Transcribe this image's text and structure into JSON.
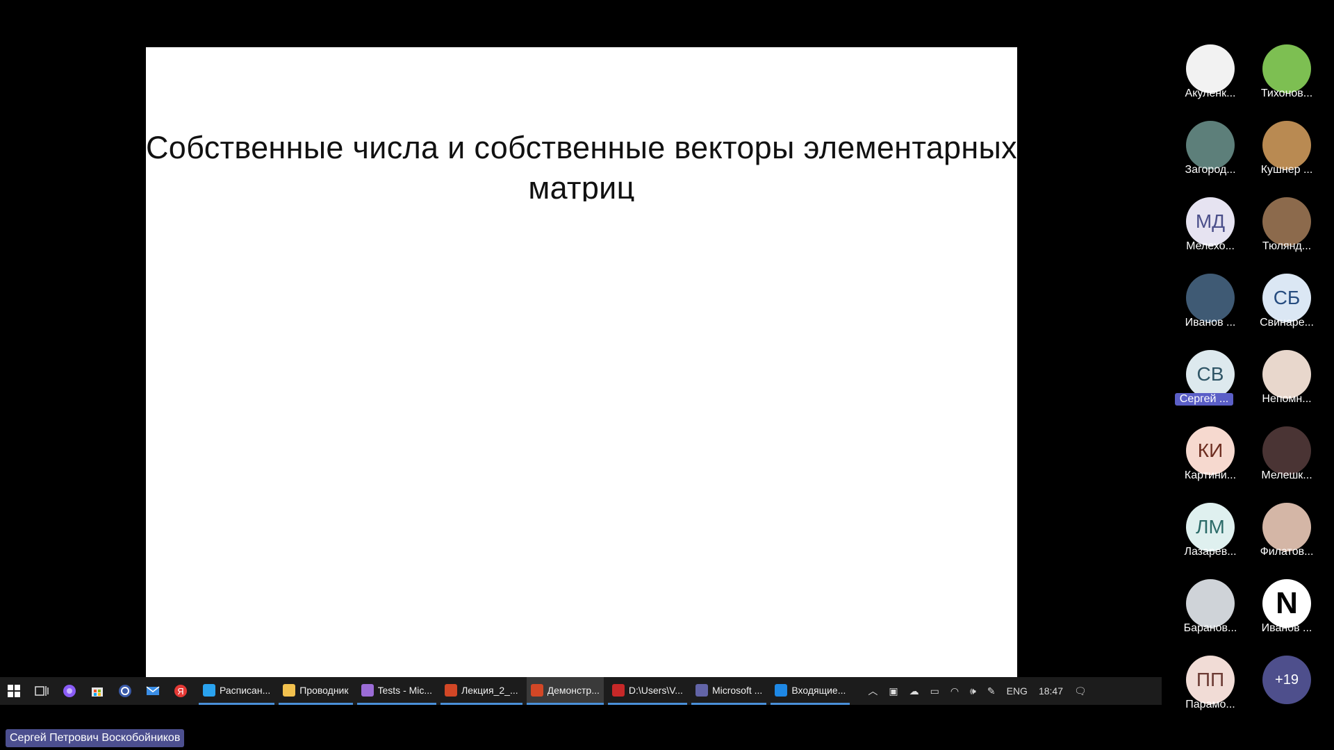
{
  "slide": {
    "title": "Собственные числа и собственные векторы элементарных матриц"
  },
  "taskbar": {
    "apps": [
      {
        "label": "Расписан...",
        "icon": "edge-icon",
        "color": "#2aa3ef"
      },
      {
        "label": "Проводник",
        "icon": "folder-icon",
        "color": "#f2c14e"
      },
      {
        "label": "Tests - Mic...",
        "icon": "visual-studio-icon",
        "color": "#9b6cd6"
      },
      {
        "label": "Лекция_2_...",
        "icon": "powerpoint-icon",
        "color": "#d24726"
      },
      {
        "label": "Демонстр...",
        "icon": "powerpoint-icon",
        "color": "#d24726"
      },
      {
        "label": "D:\\Users\\V...",
        "icon": "calendar-app-icon",
        "color": "#c62828"
      },
      {
        "label": "Microsoft ...",
        "icon": "teams-icon",
        "color": "#6264a7"
      },
      {
        "label": "Входящие...",
        "icon": "outlook-icon",
        "color": "#1e88e5"
      }
    ],
    "tray": {
      "language": "ENG",
      "time": "18:47"
    }
  },
  "participants": [
    {
      "name": "Акуленк...",
      "initials": "",
      "bg": "#f2f2f2",
      "fg": "#333"
    },
    {
      "name": "Тихонов...",
      "initials": "",
      "bg": "#7dbf52",
      "fg": "#fff"
    },
    {
      "name": "Загород...",
      "initials": "",
      "bg": "#5d7f7a",
      "fg": "#fff"
    },
    {
      "name": "Кушнер ...",
      "initials": "",
      "bg": "#b98a52",
      "fg": "#fff"
    },
    {
      "name": "Мелехо...",
      "initials": "МД",
      "bg": "#e6e3f1",
      "fg": "#4b4f8a"
    },
    {
      "name": "Тюлянд...",
      "initials": "",
      "bg": "#8c6a4c",
      "fg": "#fff"
    },
    {
      "name": "Иванов ...",
      "initials": "",
      "bg": "#3f5a74",
      "fg": "#fff"
    },
    {
      "name": "Свинаре...",
      "initials": "СБ",
      "bg": "#dbe7f4",
      "fg": "#274d80"
    },
    {
      "name": "Сергей ...",
      "initials": "СВ",
      "bg": "#dde9ee",
      "fg": "#2f5566",
      "speaking": true
    },
    {
      "name": "Непомн...",
      "initials": "",
      "bg": "#e8d7cc",
      "fg": "#333"
    },
    {
      "name": "Картини...",
      "initials": "КИ",
      "bg": "#f6d9cf",
      "fg": "#6d2d20"
    },
    {
      "name": "Мелешк...",
      "initials": "",
      "bg": "#4a3434",
      "fg": "#fff"
    },
    {
      "name": "Лазарев...",
      "initials": "ЛМ",
      "bg": "#dff0ef",
      "fg": "#2b6b68"
    },
    {
      "name": "Филатов...",
      "initials": "",
      "bg": "#d4b6a6",
      "fg": "#333"
    },
    {
      "name": "Баранов...",
      "initials": "",
      "bg": "#cfd3d8",
      "fg": "#333"
    },
    {
      "name": "Иванов ...",
      "initials": "N",
      "bg": "#ffffff",
      "fg": "#000"
    },
    {
      "name": "Парамо...",
      "initials": "ПП",
      "bg": "#f1dcd6",
      "fg": "#6b3a33"
    },
    {
      "name": "",
      "initials": "+19",
      "bg": "#4e4f8c",
      "fg": "#ffffff"
    }
  ],
  "presenter": {
    "name": "Сергей Петрович Воскобойников"
  }
}
